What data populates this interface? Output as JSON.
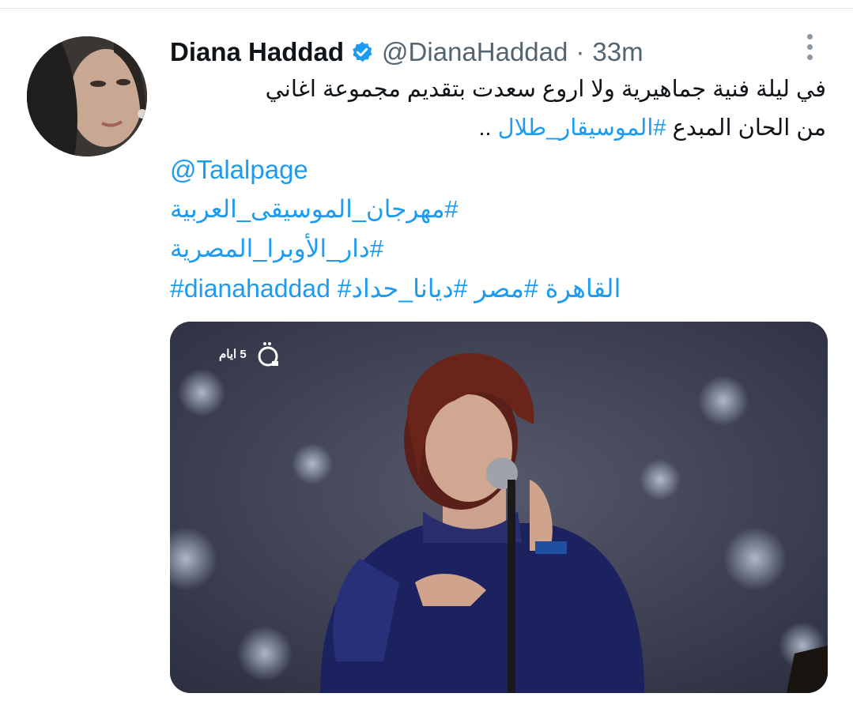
{
  "author": {
    "display_name": "Diana Haddad",
    "handle": "@DianaHaddad",
    "separator": "·",
    "time": "33m"
  },
  "tweet": {
    "line1": "في ليلة فنية جماهيرية ولا اروع سعدت بتقديم مجموعة اغاني",
    "line2_prefix": "من الحان المبدع ",
    "line2_hashtag": "#الموسيقار_طلال",
    "line2_suffix": " ..",
    "mention": "@Talalpage",
    "hashtag_1": "#مهرجان_الموسيقى_العربية",
    "hashtag_2": "#دار_الأوبرا_المصرية",
    "hashtags_last": "#dianahaddad #القاهرة #مصر #ديانا_حداد"
  },
  "media": {
    "channel_text": "5 ايام"
  },
  "colors": {
    "link": "#1d9bf0",
    "text": "#0f1419",
    "muted": "#536471",
    "verified": "#1d9bf0"
  },
  "icons": [
    "verified-badge-icon",
    "more-options-icon",
    "channel-logo-icon"
  ]
}
